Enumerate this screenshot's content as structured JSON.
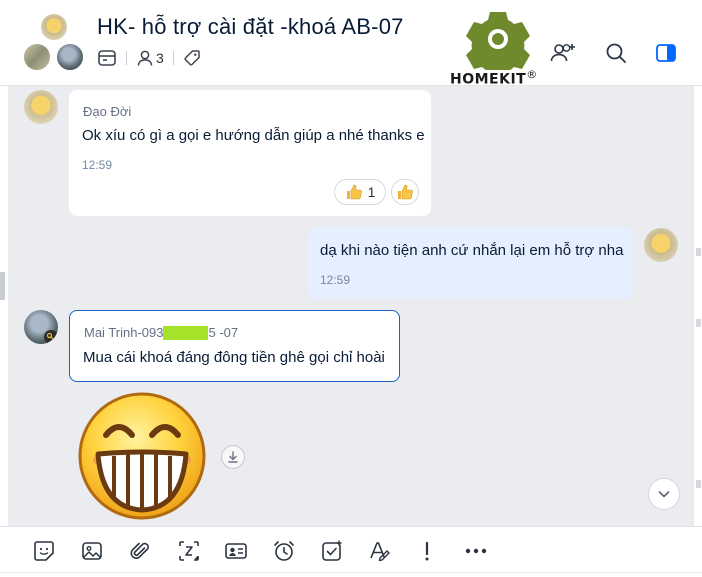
{
  "header": {
    "title": "HK- hỗ trợ cài đặt -khoá AB-07",
    "member_count": "3",
    "logo_text": "HOMEKIT",
    "logo_mark": "®",
    "logo_color": "#6e8a2d"
  },
  "messages": [
    {
      "sender": "Đạo Đời",
      "text": "Ok xíu có gì a gọi e hướng dẫn giúp a nhé thanks e",
      "time": "12:59",
      "reaction_count": "1",
      "reaction_icon": "thumbs-up"
    },
    {
      "text": "dạ khi nào tiện anh cứ nhắn lại em hỗ trợ nha",
      "time": "12:59",
      "outgoing": true
    },
    {
      "sender_prefix": "Mai Trinh-093",
      "sender_suffix": "5 -07",
      "text": "Mua cái khoá đáng đông tiền ghê gọi chỉ hoài",
      "highlight_color": "#a6e22a"
    }
  ],
  "toolbar": {
    "items": [
      "sticker-icon",
      "image-icon",
      "attach-icon",
      "screenshot-icon",
      "contact-card-icon",
      "reminder-icon",
      "task-icon",
      "text-format-icon",
      "important-icon",
      "more-icon"
    ]
  },
  "colors": {
    "accent": "#0068ff",
    "chat_bg": "#ebecf0",
    "outgoing_bubble": "#e5efff",
    "reply_border": "#1d5fbf"
  }
}
